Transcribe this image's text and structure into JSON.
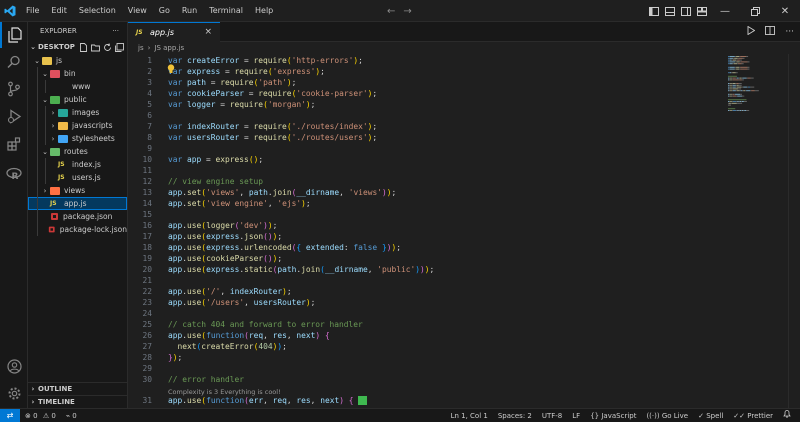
{
  "colors": {
    "accent": "#0078d4",
    "keyword": "#569cd6",
    "variable": "#9cdcfe",
    "function": "#dcdcaa",
    "string": "#ce9178",
    "comment": "#6a9955",
    "bracket_yellow": "#ffd700",
    "bracket_pink": "#da70d6",
    "bracket_blue": "#179fff"
  },
  "menu": [
    "File",
    "Edit",
    "Selection",
    "View",
    "Go",
    "Run",
    "Terminal",
    "Help"
  ],
  "sidebar": {
    "title": "EXPLORER",
    "more": "···",
    "root": "DESKTOP",
    "tree": [
      {
        "label": "js",
        "kind": "folder",
        "depth": 1,
        "open": true,
        "icon_color": "#e8c24d"
      },
      {
        "label": "bin",
        "kind": "folder",
        "depth": 2,
        "open": true,
        "icon_color": "#e0505e"
      },
      {
        "label": "www",
        "kind": "file-plain",
        "depth": 3
      },
      {
        "label": "public",
        "kind": "folder",
        "depth": 2,
        "open": true,
        "icon_color": "#4caf50"
      },
      {
        "label": "images",
        "kind": "folder",
        "depth": 3,
        "open": false,
        "icon_color": "#26a69a"
      },
      {
        "label": "javascripts",
        "kind": "folder",
        "depth": 3,
        "open": false,
        "icon_color": "#f0b948"
      },
      {
        "label": "stylesheets",
        "kind": "folder",
        "depth": 3,
        "open": false,
        "icon_color": "#42a5f5"
      },
      {
        "label": "routes",
        "kind": "folder",
        "depth": 2,
        "open": true,
        "icon_color": "#66bb6a"
      },
      {
        "label": "index.js",
        "kind": "js",
        "depth": 3
      },
      {
        "label": "users.js",
        "kind": "js",
        "depth": 3
      },
      {
        "label": "views",
        "kind": "folder",
        "depth": 2,
        "open": false,
        "icon_color": "#ff7043"
      },
      {
        "label": "app.js",
        "kind": "js",
        "depth": 2,
        "selected": true
      },
      {
        "label": "package.json",
        "kind": "json",
        "depth": 2
      },
      {
        "label": "package-lock.json",
        "kind": "json",
        "depth": 2
      }
    ],
    "outline": "OUTLINE",
    "timeline": "TIMELINE"
  },
  "tab": {
    "icon": "JS",
    "label": "app.js",
    "close": "×"
  },
  "breadcrumb": [
    "js",
    "JS app.js"
  ],
  "codelens": "Complexity is 3 Everything is cool!",
  "code_lines": [
    {
      "n": 1,
      "tokens": [
        [
          "var ",
          "kw"
        ],
        [
          "createError",
          "var"
        ],
        [
          " = ",
          "p"
        ],
        [
          "require",
          "fn"
        ],
        [
          "(",
          "b1"
        ],
        [
          "'http-errors'",
          "str"
        ],
        [
          ")",
          "b1"
        ],
        [
          ";",
          "p"
        ]
      ]
    },
    {
      "n": 2,
      "tokens": [
        [
          "var ",
          "kw"
        ],
        [
          "express",
          "var"
        ],
        [
          " = ",
          "p"
        ],
        [
          "require",
          "fn"
        ],
        [
          "(",
          "b1"
        ],
        [
          "'express'",
          "str"
        ],
        [
          ")",
          "b1"
        ],
        [
          ";",
          "p"
        ]
      ]
    },
    {
      "n": 3,
      "tokens": [
        [
          "var ",
          "kw"
        ],
        [
          "path",
          "var"
        ],
        [
          " = ",
          "p"
        ],
        [
          "require",
          "fn"
        ],
        [
          "(",
          "b1"
        ],
        [
          "'path'",
          "str"
        ],
        [
          ")",
          "b1"
        ],
        [
          ";",
          "p"
        ]
      ]
    },
    {
      "n": 4,
      "tokens": [
        [
          "var ",
          "kw"
        ],
        [
          "cookieParser",
          "var"
        ],
        [
          " = ",
          "p"
        ],
        [
          "require",
          "fn"
        ],
        [
          "(",
          "b1"
        ],
        [
          "'cookie-parser'",
          "str"
        ],
        [
          ")",
          "b1"
        ],
        [
          ";",
          "p"
        ]
      ]
    },
    {
      "n": 5,
      "tokens": [
        [
          "var ",
          "kw"
        ],
        [
          "logger",
          "var"
        ],
        [
          " = ",
          "p"
        ],
        [
          "require",
          "fn"
        ],
        [
          "(",
          "b1"
        ],
        [
          "'morgan'",
          "str"
        ],
        [
          ")",
          "b1"
        ],
        [
          ";",
          "p"
        ]
      ]
    },
    {
      "n": 6,
      "tokens": []
    },
    {
      "n": 7,
      "tokens": [
        [
          "var ",
          "kw"
        ],
        [
          "indexRouter",
          "var"
        ],
        [
          " = ",
          "p"
        ],
        [
          "require",
          "fn"
        ],
        [
          "(",
          "b1"
        ],
        [
          "'./routes/index'",
          "str"
        ],
        [
          ")",
          "b1"
        ],
        [
          ";",
          "p"
        ]
      ]
    },
    {
      "n": 8,
      "tokens": [
        [
          "var ",
          "kw"
        ],
        [
          "usersRouter",
          "var"
        ],
        [
          " = ",
          "p"
        ],
        [
          "require",
          "fn"
        ],
        [
          "(",
          "b1"
        ],
        [
          "'./routes/users'",
          "str"
        ],
        [
          ")",
          "b1"
        ],
        [
          ";",
          "p"
        ]
      ]
    },
    {
      "n": 9,
      "tokens": []
    },
    {
      "n": 10,
      "tokens": [
        [
          "var ",
          "kw"
        ],
        [
          "app",
          "var"
        ],
        [
          " = ",
          "p"
        ],
        [
          "express",
          "fn"
        ],
        [
          "()",
          "b1"
        ],
        [
          ";",
          "p"
        ]
      ]
    },
    {
      "n": 11,
      "tokens": []
    },
    {
      "n": 12,
      "tokens": [
        [
          "// view engine setup",
          "cm"
        ]
      ]
    },
    {
      "n": 13,
      "tokens": [
        [
          "app",
          "var"
        ],
        [
          ".",
          "p"
        ],
        [
          "set",
          "fn"
        ],
        [
          "(",
          "b1"
        ],
        [
          "'views'",
          "str"
        ],
        [
          ", ",
          "p"
        ],
        [
          "path",
          "var"
        ],
        [
          ".",
          "p"
        ],
        [
          "join",
          "fn"
        ],
        [
          "(",
          "b2"
        ],
        [
          "__dirname",
          "var"
        ],
        [
          ", ",
          "p"
        ],
        [
          "'views'",
          "str"
        ],
        [
          ")",
          "b2"
        ],
        [
          ")",
          "b1"
        ],
        [
          ";",
          "p"
        ]
      ]
    },
    {
      "n": 14,
      "tokens": [
        [
          "app",
          "var"
        ],
        [
          ".",
          "p"
        ],
        [
          "set",
          "fn"
        ],
        [
          "(",
          "b1"
        ],
        [
          "'view engine'",
          "str"
        ],
        [
          ", ",
          "p"
        ],
        [
          "'ejs'",
          "str"
        ],
        [
          ")",
          "b1"
        ],
        [
          ";",
          "p"
        ]
      ]
    },
    {
      "n": 15,
      "tokens": []
    },
    {
      "n": 16,
      "tokens": [
        [
          "app",
          "var"
        ],
        [
          ".",
          "p"
        ],
        [
          "use",
          "fn"
        ],
        [
          "(",
          "b1"
        ],
        [
          "logger",
          "fn"
        ],
        [
          "(",
          "b2"
        ],
        [
          "'dev'",
          "str"
        ],
        [
          ")",
          "b2"
        ],
        [
          ")",
          "b1"
        ],
        [
          ";",
          "p"
        ]
      ]
    },
    {
      "n": 17,
      "tokens": [
        [
          "app",
          "var"
        ],
        [
          ".",
          "p"
        ],
        [
          "use",
          "fn"
        ],
        [
          "(",
          "b1"
        ],
        [
          "express",
          "var"
        ],
        [
          ".",
          "p"
        ],
        [
          "json",
          "fn"
        ],
        [
          "()",
          "b2"
        ],
        [
          ")",
          "b1"
        ],
        [
          ";",
          "p"
        ]
      ]
    },
    {
      "n": 18,
      "tokens": [
        [
          "app",
          "var"
        ],
        [
          ".",
          "p"
        ],
        [
          "use",
          "fn"
        ],
        [
          "(",
          "b1"
        ],
        [
          "express",
          "var"
        ],
        [
          ".",
          "p"
        ],
        [
          "urlencoded",
          "fn"
        ],
        [
          "(",
          "b2"
        ],
        [
          "{ ",
          "b3"
        ],
        [
          "extended",
          "var"
        ],
        [
          ": ",
          "p"
        ],
        [
          "false",
          "kw"
        ],
        [
          " }",
          "b3"
        ],
        [
          ")",
          "b2"
        ],
        [
          ")",
          "b1"
        ],
        [
          ";",
          "p"
        ]
      ]
    },
    {
      "n": 19,
      "tokens": [
        [
          "app",
          "var"
        ],
        [
          ".",
          "p"
        ],
        [
          "use",
          "fn"
        ],
        [
          "(",
          "b1"
        ],
        [
          "cookieParser",
          "fn"
        ],
        [
          "()",
          "b2"
        ],
        [
          ")",
          "b1"
        ],
        [
          ";",
          "p"
        ]
      ]
    },
    {
      "n": 20,
      "tokens": [
        [
          "app",
          "var"
        ],
        [
          ".",
          "p"
        ],
        [
          "use",
          "fn"
        ],
        [
          "(",
          "b1"
        ],
        [
          "express",
          "var"
        ],
        [
          ".",
          "p"
        ],
        [
          "static",
          "fn"
        ],
        [
          "(",
          "b2"
        ],
        [
          "path",
          "var"
        ],
        [
          ".",
          "p"
        ],
        [
          "join",
          "fn"
        ],
        [
          "(",
          "b3"
        ],
        [
          "__dirname",
          "var"
        ],
        [
          ", ",
          "p"
        ],
        [
          "'public'",
          "str"
        ],
        [
          ")",
          "b3"
        ],
        [
          ")",
          "b2"
        ],
        [
          ")",
          "b1"
        ],
        [
          ";",
          "p"
        ]
      ]
    },
    {
      "n": 21,
      "tokens": []
    },
    {
      "n": 22,
      "tokens": [
        [
          "app",
          "var"
        ],
        [
          ".",
          "p"
        ],
        [
          "use",
          "fn"
        ],
        [
          "(",
          "b1"
        ],
        [
          "'/'",
          "str"
        ],
        [
          ", ",
          "p"
        ],
        [
          "indexRouter",
          "var"
        ],
        [
          ")",
          "b1"
        ],
        [
          ";",
          "p"
        ]
      ]
    },
    {
      "n": 23,
      "tokens": [
        [
          "app",
          "var"
        ],
        [
          ".",
          "p"
        ],
        [
          "use",
          "fn"
        ],
        [
          "(",
          "b1"
        ],
        [
          "'/users'",
          "str"
        ],
        [
          ", ",
          "p"
        ],
        [
          "usersRouter",
          "var"
        ],
        [
          ")",
          "b1"
        ],
        [
          ";",
          "p"
        ]
      ]
    },
    {
      "n": 24,
      "tokens": []
    },
    {
      "n": 25,
      "tokens": [
        [
          "// catch 404 and forward to error handler",
          "cm"
        ]
      ]
    },
    {
      "n": 26,
      "tokens": [
        [
          "app",
          "var"
        ],
        [
          ".",
          "p"
        ],
        [
          "use",
          "fn"
        ],
        [
          "(",
          "b1"
        ],
        [
          "function",
          "kw"
        ],
        [
          "(",
          "b2"
        ],
        [
          "req",
          "var"
        ],
        [
          ", ",
          "p"
        ],
        [
          "res",
          "var"
        ],
        [
          ", ",
          "p"
        ],
        [
          "next",
          "var"
        ],
        [
          ")",
          "b2"
        ],
        [
          " ",
          "p"
        ],
        [
          "{",
          "b2"
        ]
      ]
    },
    {
      "n": 27,
      "tokens": [
        [
          "  ",
          "p"
        ],
        [
          "next",
          "fn"
        ],
        [
          "(",
          "b3"
        ],
        [
          "createError",
          "fn"
        ],
        [
          "(",
          "b1"
        ],
        [
          "404",
          "num"
        ],
        [
          ")",
          "b1"
        ],
        [
          ")",
          "b3"
        ],
        [
          ";",
          "p"
        ]
      ]
    },
    {
      "n": 28,
      "tokens": [
        [
          "}",
          "b2"
        ],
        [
          ")",
          "b1"
        ],
        [
          ";",
          "p"
        ]
      ]
    },
    {
      "n": 29,
      "tokens": []
    },
    {
      "n": 30,
      "tokens": [
        [
          "// error handler",
          "cm"
        ]
      ]
    },
    {
      "n": 31,
      "tokens": [
        [
          "app",
          "var"
        ],
        [
          ".",
          "p"
        ],
        [
          "use",
          "fn"
        ],
        [
          "(",
          "b1"
        ],
        [
          "function",
          "kw"
        ],
        [
          "(",
          "b2"
        ],
        [
          "err",
          "var"
        ],
        [
          ", ",
          "p"
        ],
        [
          "req",
          "var"
        ],
        [
          ", ",
          "p"
        ],
        [
          "res",
          "var"
        ],
        [
          ", ",
          "p"
        ],
        [
          "next",
          "var"
        ],
        [
          ")",
          "b2"
        ],
        [
          " ",
          "p"
        ],
        [
          "{",
          "b2"
        ]
      ]
    }
  ],
  "status": {
    "remote": "⇄",
    "errors": "0",
    "warnings": "0",
    "ports": "0",
    "position": "Ln 1, Col 1",
    "spaces": "Spaces: 2",
    "encoding": "UTF-8",
    "eol": "LF",
    "language": "JavaScript",
    "golive": "Go Live",
    "spell": "Spell",
    "prettier": "Prettier"
  }
}
